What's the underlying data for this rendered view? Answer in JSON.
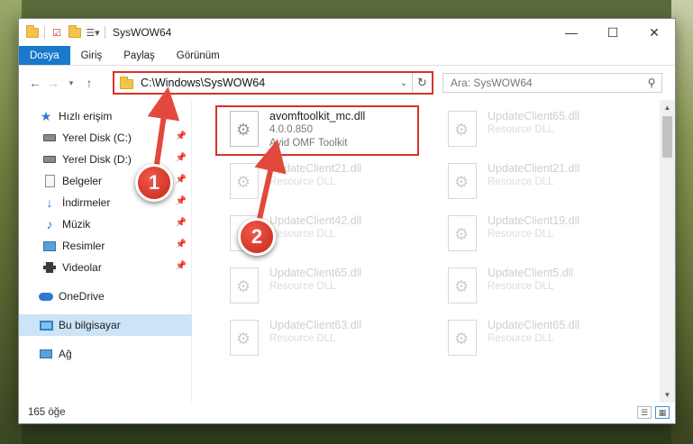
{
  "window": {
    "title": "SysWOW64",
    "minimize_glyph": "—",
    "maximize_glyph": "☐",
    "close_glyph": "✕"
  },
  "ribbon": {
    "tabs": [
      "Dosya",
      "Giriş",
      "Paylaş",
      "Görünüm"
    ],
    "active_tab": "Dosya"
  },
  "address": {
    "path": "C:\\Windows\\SysWOW64",
    "search_placeholder": "Ara: SysWOW64"
  },
  "sidebar": {
    "quick_access": "Hızlı erişim",
    "items": [
      {
        "label": "Yerel Disk (C:)",
        "icon": "disk-icon"
      },
      {
        "label": "Yerel Disk (D:)",
        "icon": "disk-icon"
      },
      {
        "label": "Belgeler",
        "icon": "document-icon"
      },
      {
        "label": "İndirmeler",
        "icon": "download-icon"
      },
      {
        "label": "Müzik",
        "icon": "music-icon"
      },
      {
        "label": "Resimler",
        "icon": "pictures-icon"
      },
      {
        "label": "Videolar",
        "icon": "videos-icon"
      }
    ],
    "onedrive": "OneDrive",
    "this_pc": "Bu bilgisayar",
    "network": "Ağ"
  },
  "files": [
    {
      "name": "avomftoolkit_mc.dll",
      "line2": "4.0.0.850",
      "line3": "Avid OMF Toolkit",
      "highlighted": true
    },
    {
      "name": "UpdateClient65.dll",
      "line2": "Resource DLL"
    },
    {
      "name": "UpdateClient21.dll",
      "line2": "Resource DLL"
    },
    {
      "name": "UpdateClient21.dll",
      "line2": "Resource DLL"
    },
    {
      "name": "UpdateClient42.dll",
      "line2": "Resource DLL"
    },
    {
      "name": "UpdateClient19.dll",
      "line2": "Resource DLL"
    },
    {
      "name": "UpdateClient65.dll",
      "line2": "Resource DLL"
    },
    {
      "name": "UpdateClient5.dll",
      "line2": "Resource DLL"
    },
    {
      "name": "UpdateClient63.dll",
      "line2": "Resource DLL"
    },
    {
      "name": "UpdateClient65.dll",
      "line2": "Resource DLL"
    }
  ],
  "status": {
    "item_count": "165 öğe"
  },
  "annotations": {
    "step1": "1",
    "step2": "2",
    "color": "#d9302c"
  }
}
